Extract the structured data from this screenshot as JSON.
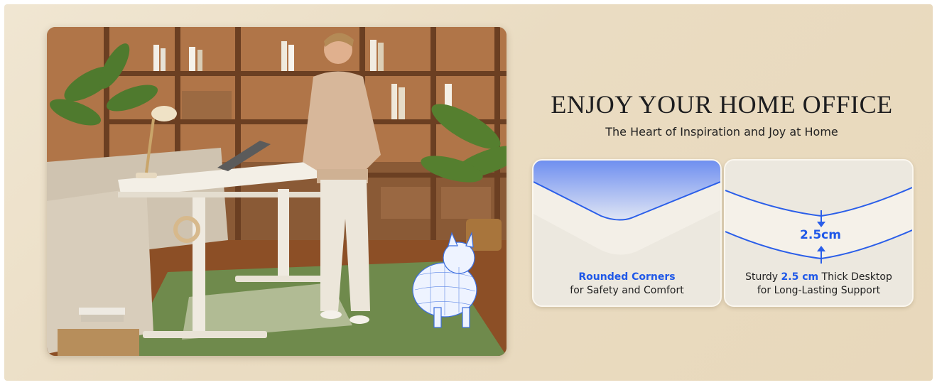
{
  "headline": "ENJOY YOUR HOME OFFICE",
  "subheadline": "The Heart of Inspiration and Joy at Home",
  "features": [
    {
      "title": "Rounded Corners",
      "subtitle": "for Safety and Comfort"
    },
    {
      "line1_prefix": "Sturdy ",
      "line1_highlight": "2.5 cm",
      "line1_suffix": " Thick Desktop",
      "subtitle": "for Long-Lasting Support",
      "measurement_label": "2.5cm"
    }
  ],
  "colors": {
    "accent_blue": "#1f58e8",
    "background": "#eadcc2",
    "headline_text": "#1d1d1f"
  }
}
